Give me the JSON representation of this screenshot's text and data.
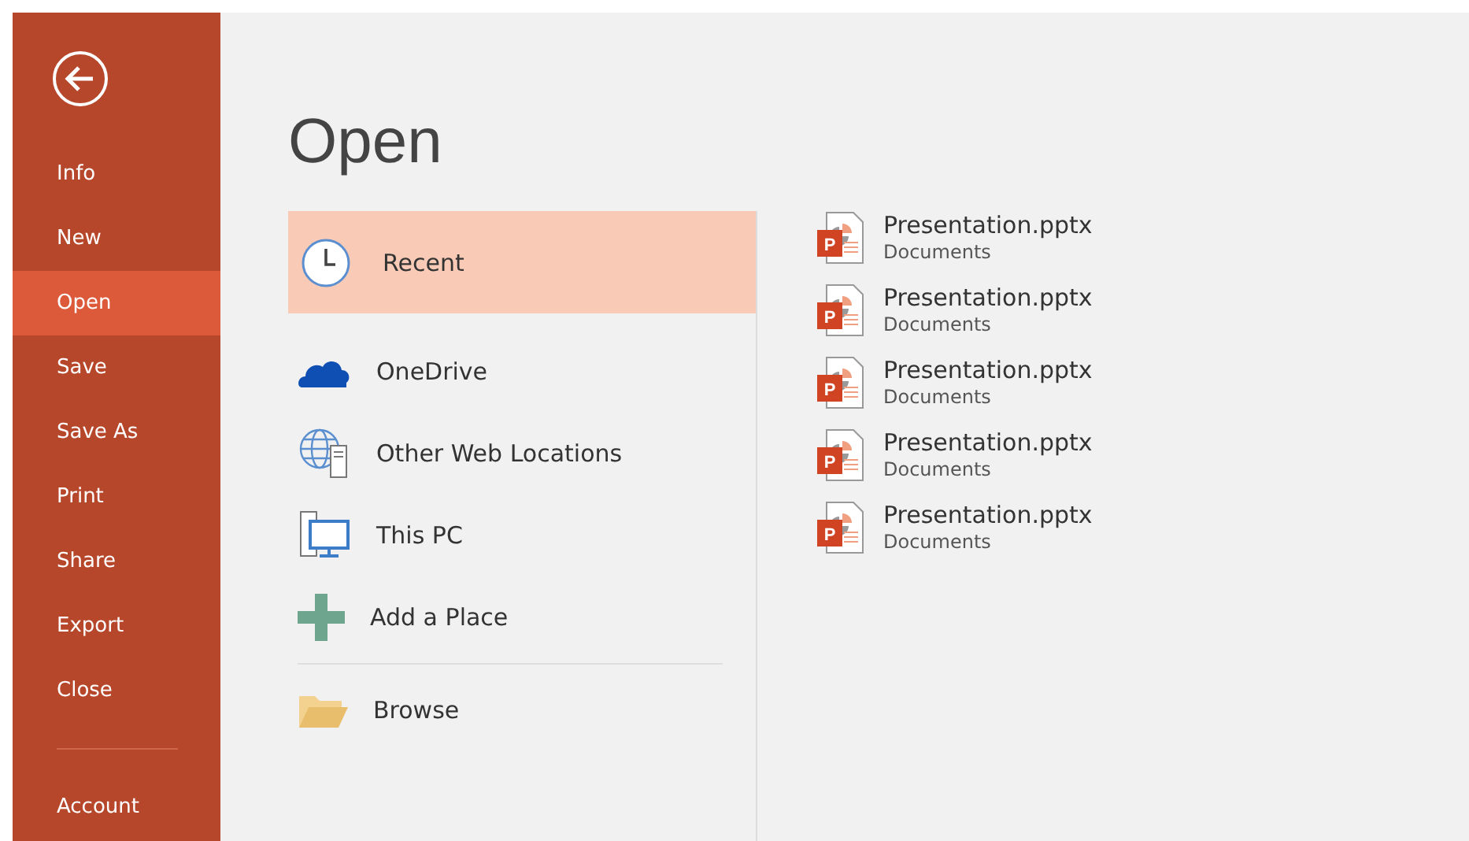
{
  "sidebar": {
    "items": [
      {
        "label": "Info",
        "selected": false
      },
      {
        "label": "New",
        "selected": false
      },
      {
        "label": "Open",
        "selected": true
      },
      {
        "label": "Save",
        "selected": false
      },
      {
        "label": "Save As",
        "selected": false
      },
      {
        "label": "Print",
        "selected": false
      },
      {
        "label": "Share",
        "selected": false
      },
      {
        "label": "Export",
        "selected": false
      },
      {
        "label": "Close",
        "selected": false
      }
    ],
    "footer_items": [
      {
        "label": "Account",
        "selected": false
      }
    ]
  },
  "title": "Open",
  "locations": [
    {
      "kind": "clock",
      "label": "Recent",
      "selected": true
    },
    {
      "kind": "cloud",
      "label": "OneDrive",
      "selected": false
    },
    {
      "kind": "globe",
      "label": "Other Web Locations",
      "selected": false
    },
    {
      "kind": "pc",
      "label": "This PC",
      "selected": false
    },
    {
      "kind": "plus",
      "label": "Add a Place",
      "selected": false
    },
    {
      "kind": "folder",
      "label": "Browse",
      "selected": false
    }
  ],
  "files": [
    {
      "name": "Presentation.pptx",
      "folder": "Documents",
      "badge": "P"
    },
    {
      "name": "Presentation.pptx",
      "folder": "Documents",
      "badge": "P"
    },
    {
      "name": "Presentation.pptx",
      "folder": "Documents",
      "badge": "P"
    },
    {
      "name": "Presentation.pptx",
      "folder": "Documents",
      "badge": "P"
    },
    {
      "name": "Presentation.pptx",
      "folder": "Documents",
      "badge": "P"
    }
  ]
}
